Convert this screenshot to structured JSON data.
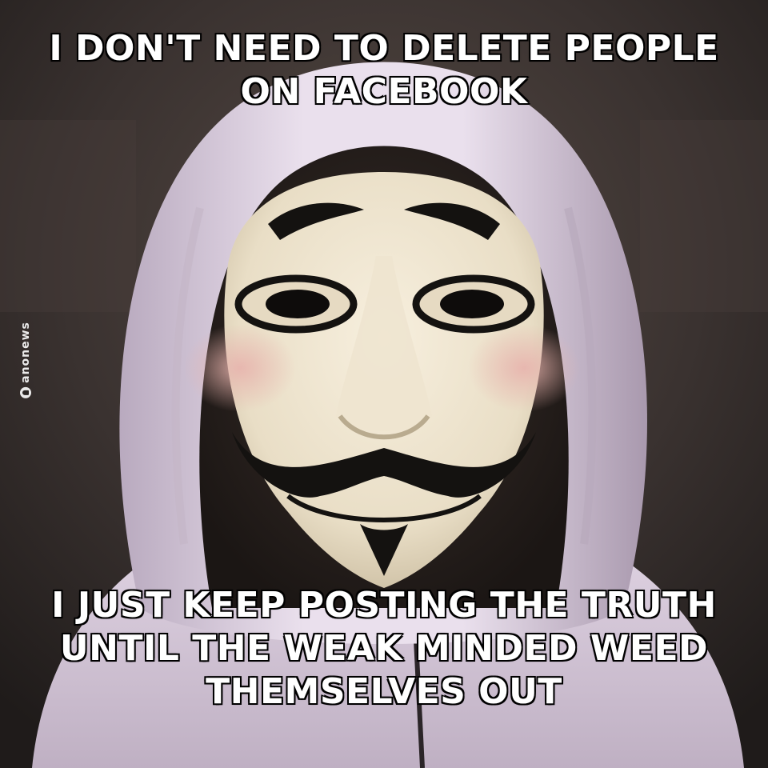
{
  "meme": {
    "top_lines": [
      "I DON'T NEED TO DELETE PEOPLE",
      "ON FACEBOOK"
    ],
    "bottom_lines": [
      "I JUST KEEP POSTING THE TRUTH",
      "UNTIL THE WEAK MINDED WEED",
      "THEMSELVES OUT"
    ]
  },
  "watermark": {
    "text": "anonews",
    "logo": "anonymous-mask-logo"
  },
  "photo": {
    "subject": "guy-fawkes-mask-icon",
    "colors": {
      "background": "#2a2523",
      "hoodie": "#e7dcea",
      "hoodie_shadow": "#b8a9bd",
      "mask": "#efe6d4",
      "mask_shadow": "#cbbfa6",
      "mask_cheeks": "#e8bcb6",
      "markings": "#141210",
      "caption_text": "#ffffff",
      "caption_stroke": "#000000"
    }
  }
}
